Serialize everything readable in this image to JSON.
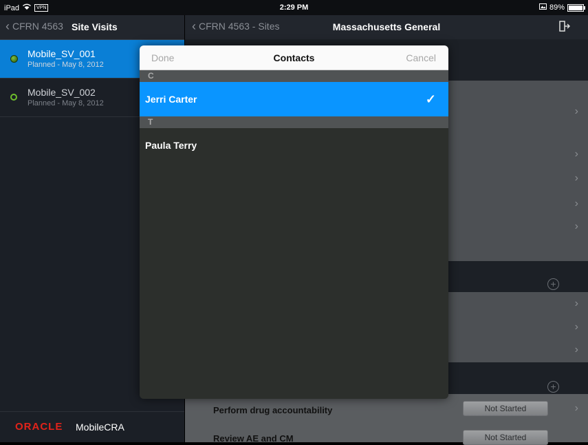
{
  "statusbar": {
    "device": "iPad",
    "vpn": "VPN",
    "time": "2:29 PM",
    "battery": "89%",
    "battery_level": 0.89
  },
  "left": {
    "back_label": "CFRN 4563",
    "title": "Site Visits",
    "visits": [
      {
        "name": "Mobile_SV_001",
        "sub": "Planned - May 8, 2012"
      },
      {
        "name": "Mobile_SV_002",
        "sub": "Planned - May 8, 2012"
      }
    ],
    "footer_brand": "ORACLE",
    "footer_product": "MobileCRA"
  },
  "right": {
    "back_label": "CFRN 4563 - Sites",
    "title": "Massachusetts General",
    "tasks": [
      {
        "label": "Perform drug accountability",
        "status": "Not Started"
      },
      {
        "label": "Review AE and CM",
        "status": "Not Started"
      }
    ]
  },
  "modal": {
    "done": "Done",
    "title": "Contacts",
    "cancel": "Cancel",
    "sections": [
      {
        "letter": "C",
        "contact": "Jerri Carter",
        "selected": true
      },
      {
        "letter": "T",
        "contact": "Paula Terry",
        "selected": false
      }
    ]
  }
}
